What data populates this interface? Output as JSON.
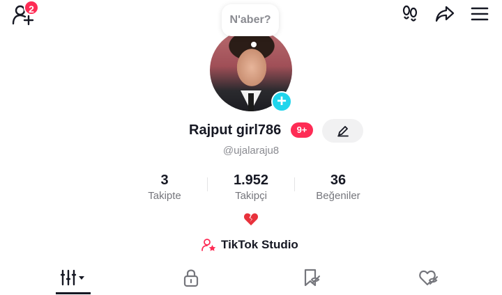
{
  "header": {
    "friend_request_count": "2",
    "icons": [
      "add-friend-icon",
      "footprints-icon",
      "share-icon",
      "menu-icon"
    ]
  },
  "status_bubble": {
    "text": "N'aber?"
  },
  "profile": {
    "display_name": "Rajput girl786",
    "notification_badge": "9+",
    "username": "@ujalaraju8"
  },
  "stats": [
    {
      "value": "3",
      "label": "Takipte"
    },
    {
      "value": "1.952",
      "label": "Takipçi"
    },
    {
      "value": "36",
      "label": "Beğeniler"
    }
  ],
  "bio": {
    "emoji": "💔"
  },
  "studio": {
    "label": "TikTok Studio"
  },
  "tabs": [
    {
      "icon": "videos-grid-icon",
      "active": true
    },
    {
      "icon": "lock-icon",
      "active": false
    },
    {
      "icon": "bookmark-icon",
      "active": false
    },
    {
      "icon": "liked-heart-icon",
      "active": false
    }
  ],
  "colors": {
    "accent_red": "#fe2c55",
    "plus_cyan": "#20d5ec",
    "text_dark": "#161823",
    "text_grey": "#8a8b91"
  }
}
